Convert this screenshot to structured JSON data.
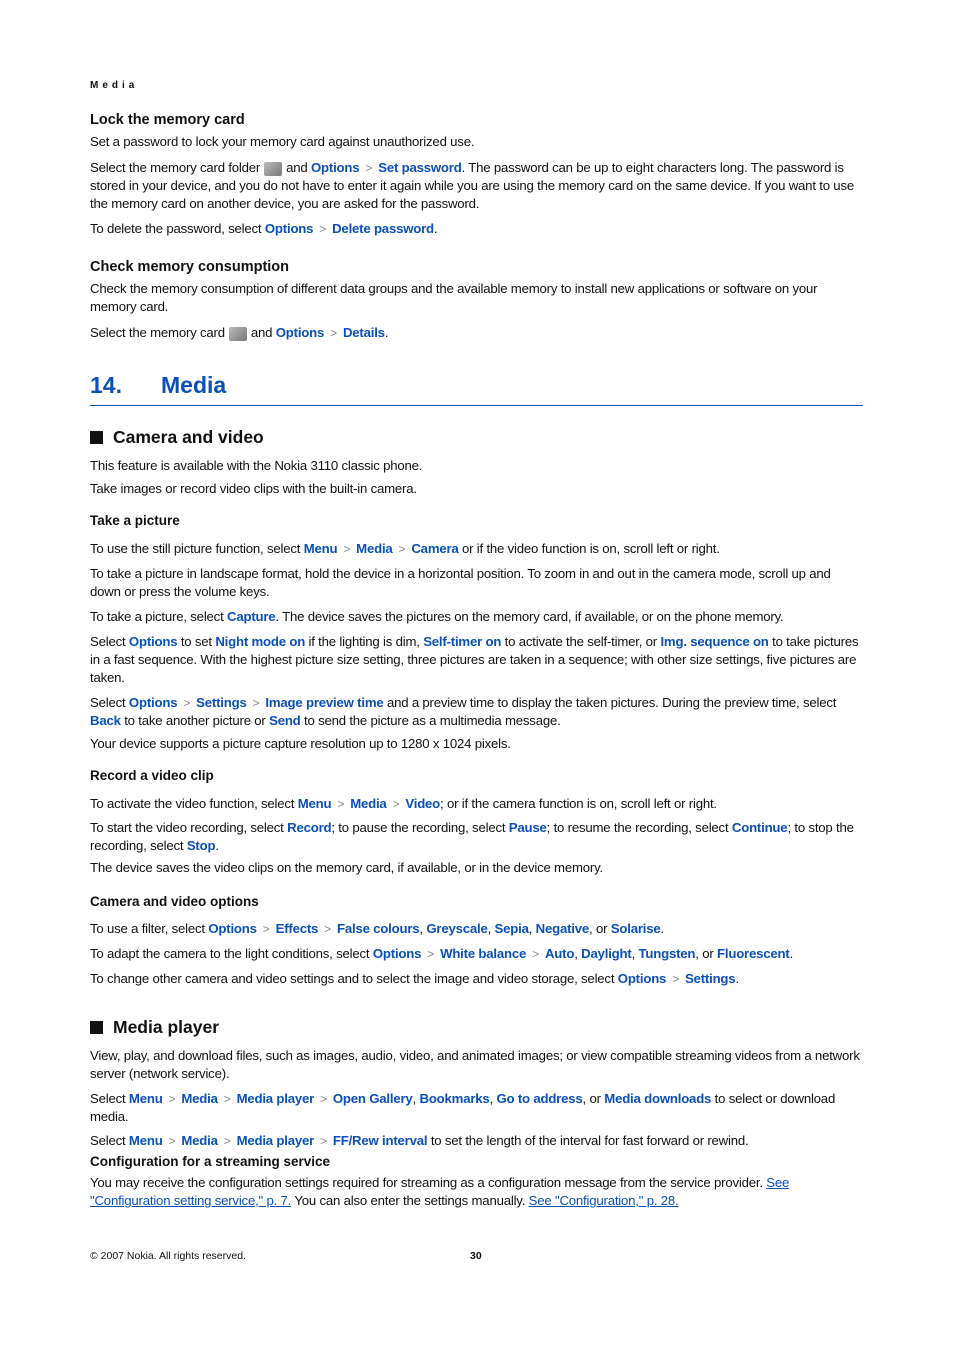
{
  "running_head": "Media",
  "lock": {
    "heading": "Lock the memory card",
    "p1": "Set a password to lock your memory card against unauthorized use.",
    "p2_a": "Select the memory card folder",
    "p2_b": "and",
    "p2_opt": "Options",
    "p2_set": "Set password",
    "p2_c": ". The password can be up to eight characters long. The password is stored in your device, and you do not have to enter it again while you are using the memory card on the same device. If you want to use the memory card on another device, you are asked for the password.",
    "p3_a": "To delete the password, select",
    "p3_opt": "Options",
    "p3_del": "Delete password",
    "p3_end": "."
  },
  "check": {
    "heading": "Check memory consumption",
    "p1": "Check the memory consumption of different data groups and the available memory to install new applications or software on your memory card.",
    "p2_a": "Select the memory card",
    "p2_b": "and",
    "p2_opt": "Options",
    "p2_det": "Details",
    "p2_end": "."
  },
  "chapter": {
    "number": "14.",
    "title": "Media"
  },
  "camera": {
    "heading": "Camera and video",
    "p1": "This feature is available with the Nokia 3110 classic phone.",
    "p2": "Take images or record video clips with the built-in camera.",
    "take": {
      "heading": "Take a picture",
      "p1_a": "To use the still picture function, select",
      "menu": "Menu",
      "media": "Media",
      "camera": "Camera",
      "p1_b": "or if the video function is on, scroll left or right.",
      "p2": "To take a picture in landscape format, hold the device in a horizontal position. To zoom in and out in the camera mode, scroll up and down or press the volume keys.",
      "p3_a": "To take a picture, select",
      "capture": "Capture",
      "p3_b": ". The device saves the pictures on the memory card, if available, or on the phone memory.",
      "p4_a": "Select",
      "options": "Options",
      "p4_b": "to set",
      "night": "Night mode on",
      "p4_c": "if the lighting is dim,",
      "selftimer": "Self-timer on",
      "p4_d": "to activate the self-timer, or",
      "imgseq": "Img. sequence on",
      "p4_e": "to take pictures in a fast sequence. With the highest picture size setting, three pictures are taken in a sequence; with other size settings, five pictures are taken.",
      "p5_a": "Select",
      "settings": "Settings",
      "preview": "Image preview time",
      "p5_b": "and a preview time to display the taken pictures. During the preview time, select",
      "back": "Back",
      "p5_c": "to take another picture or",
      "send": "Send",
      "p5_d": "to send the picture as a multimedia message.",
      "p6": "Your device supports a picture capture resolution up to 1280 x 1024 pixels."
    },
    "record": {
      "heading": "Record a video clip",
      "p1_a": "To activate the video function, select",
      "video": "Video",
      "p1_b": "; or if the camera function is on, scroll left or right.",
      "p2_a": "To start the video recording, select",
      "rec": "Record",
      "p2_b": "; to pause the recording, select",
      "pause": "Pause",
      "p2_c": "; to resume the recording, select",
      "cont": "Continue",
      "p2_d": "; to stop the recording, select",
      "stop": "Stop",
      "p2_e": ".",
      "p3": "The device saves the video clips on the memory card, if available, or in the device memory."
    },
    "opts": {
      "heading": "Camera and video options",
      "p1_a": "To use a filter, select",
      "effects": "Effects",
      "false": "False colours",
      "grey": "Greyscale",
      "sepia": "Sepia",
      "neg": "Negative",
      "or": ", or",
      "sol": "Solarise",
      "p2_a": "To adapt the camera to the light conditions, select",
      "wb": "White balance",
      "auto": "Auto",
      "day": "Daylight",
      "tung": "Tungsten",
      "fluo": "Fluorescent",
      "p3_a": "To change other camera and video settings and to select the image and video storage, select"
    }
  },
  "player": {
    "heading": "Media player",
    "p1": "View, play, and download files, such as images, audio, video, and animated images; or view compatible streaming videos from a network server (network service).",
    "mp": "Media player",
    "gallery": "Open Gallery",
    "bookmarks": "Bookmarks",
    "goto": "Go to address",
    "downloads": "Media downloads",
    "p2_end": "to select or download media.",
    "ff": "FF/Rew interval",
    "p3_end": "to set the length of the interval for fast forward or rewind.",
    "config_heading": "Configuration for a streaming service",
    "p4_a": "You may receive the configuration settings required for streaming as a configuration message from the service provider.",
    "link1": "See \"Configuration setting service,\" p. 7.",
    "p4_b": "You can also enter the settings manually.",
    "link2": "See \"Configuration,\" p. 28."
  },
  "footer": {
    "copyright": "© 2007 Nokia. All rights reserved.",
    "page": "30"
  },
  "colors": {
    "link": "#0b50b8",
    "text": "#111111"
  }
}
